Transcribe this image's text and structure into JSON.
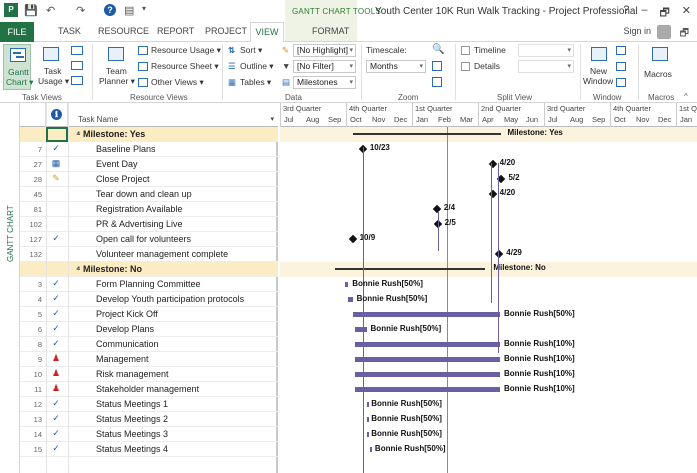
{
  "title_bar": {
    "context_tab_group": "GANTT CHART TOOLS",
    "document_title": "Youth Center 10K Run Walk Tracking - Project Professional",
    "help": "?",
    "minimize": "–",
    "restore": "🗗",
    "close": "✕"
  },
  "tabs": [
    {
      "label": "FILE"
    },
    {
      "label": "TASK"
    },
    {
      "label": "RESOURCE"
    },
    {
      "label": "REPORT"
    },
    {
      "label": "PROJECT"
    },
    {
      "label": "VIEW",
      "active": true
    },
    {
      "label": "FORMAT"
    }
  ],
  "sign_in": "Sign in",
  "ribbon": {
    "task_views": {
      "group_label": "Task Views",
      "gantt_chart": "Gantt",
      "gantt_chart2": "Chart ▾",
      "task_usage": "Task",
      "task_usage2": "Usage ▾"
    },
    "resource_views": {
      "group_label": "Resource Views",
      "team_planner": "Team",
      "team_planner2": "Planner ▾",
      "resource_usage": "Resource Usage ▾",
      "resource_sheet": "Resource Sheet ▾",
      "other_views": "Other Views ▾"
    },
    "data": {
      "group_label": "Data",
      "sort": "Sort ▾",
      "outline": "Outline ▾",
      "tables": "Tables ▾",
      "highlight_value": "[No Highlight]",
      "filter_value": "[No Filter]",
      "group_by_value": "Milestones"
    },
    "zoom": {
      "group_label": "Zoom",
      "timescale_label": "Timescale:",
      "timescale_value": "Months"
    },
    "split_view": {
      "group_label": "Split View",
      "timeline": "Timeline",
      "details": "Details"
    },
    "window": {
      "group_label": "Window",
      "new_window": "New",
      "new_window2": "Window"
    },
    "macros": {
      "group_label": "Macros",
      "macros": "Macros"
    }
  },
  "side_label": "GANTT CHART",
  "table": {
    "columns": {
      "indicators": "ℹ",
      "task_name": "Task Name"
    },
    "rows": [
      {
        "id": "",
        "indicator": "",
        "name": "⁴ Milestone: Yes",
        "group": true
      },
      {
        "id": "7",
        "indicator": "check",
        "name": "Baseline Plans"
      },
      {
        "id": "27",
        "indicator": "calendar",
        "name": "Event Day"
      },
      {
        "id": "28",
        "indicator": "note",
        "name": "Close Project"
      },
      {
        "id": "45",
        "indicator": "",
        "name": "Tear down and clean up"
      },
      {
        "id": "81",
        "indicator": "",
        "name": "Registration Available"
      },
      {
        "id": "102",
        "indicator": "",
        "name": "PR & Advertising Live"
      },
      {
        "id": "127",
        "indicator": "check",
        "name": "Open call for volunteers"
      },
      {
        "id": "132",
        "indicator": "",
        "name": "Volunteer management complete"
      },
      {
        "id": "",
        "indicator": "",
        "name": "⁴ Milestone: No",
        "group": true
      },
      {
        "id": "3",
        "indicator": "check",
        "name": "Form Planning Committee"
      },
      {
        "id": "4",
        "indicator": "check",
        "name": "Develop Youth participation protocols"
      },
      {
        "id": "5",
        "indicator": "check",
        "name": "Project Kick Off"
      },
      {
        "id": "6",
        "indicator": "check",
        "name": "Develop Plans"
      },
      {
        "id": "8",
        "indicator": "check",
        "name": "Communication"
      },
      {
        "id": "9",
        "indicator": "person",
        "name": "Management"
      },
      {
        "id": "10",
        "indicator": "person",
        "name": "Risk management"
      },
      {
        "id": "11",
        "indicator": "person",
        "name": "Stakeholder management"
      },
      {
        "id": "12",
        "indicator": "check",
        "name": "Status Meetings 1"
      },
      {
        "id": "13",
        "indicator": "check",
        "name": "Status Meetings 2"
      },
      {
        "id": "14",
        "indicator": "check",
        "name": "Status Meetings 3"
      },
      {
        "id": "15",
        "indicator": "check",
        "name": "Status Meetings 4"
      }
    ]
  },
  "timescale": {
    "quarters": [
      "3rd Quarter",
      "4th Quarter",
      "1st Quarter",
      "2nd Quarter",
      "3rd Quarter",
      "4th Quarter",
      "1st Q"
    ],
    "months": [
      "Jul",
      "Aug",
      "Sep",
      "Oct",
      "Nov",
      "Dec",
      "Jan",
      "Feb",
      "Mar",
      "Apr",
      "May",
      "Jun",
      "Jul",
      "Aug",
      "Sep",
      "Oct",
      "Nov",
      "Dec",
      "Jan"
    ]
  },
  "gantt_labels": {
    "milestone_yes": "Milestone: Yes",
    "milestone_no": "Milestone: No",
    "baseline": "10/23",
    "event_day": "4/20",
    "close_project": "5/2",
    "tear_down": "4/20",
    "registration": "2/4",
    "pr": "2/5",
    "volunteers": "10/9",
    "volunteer_mgmt": "4/29",
    "r3": "Bonnie Rush[50%]",
    "r4": "Bonnie Rush[50%]",
    "r5": "Bonnie Rush[50%]",
    "r6": "Bonnie Rush[50%]",
    "r8": "Bonnie Rush[10%]",
    "r9": "Bonnie Rush[10%]",
    "r10": "Bonnie Rush[10%]",
    "r11": "Bonnie Rush[10%]",
    "r12": "Bonnie Rush[50%]",
    "r13": "Bonnie Rush[50%]",
    "r14": "Bonnie Rush[50%]",
    "r15": "Bonnie Rush[50%]"
  },
  "colors": {
    "brand": "#217346",
    "bar": "#6b5ea3",
    "group_row": "#fbecc4",
    "today_line": "#6aa84f"
  }
}
